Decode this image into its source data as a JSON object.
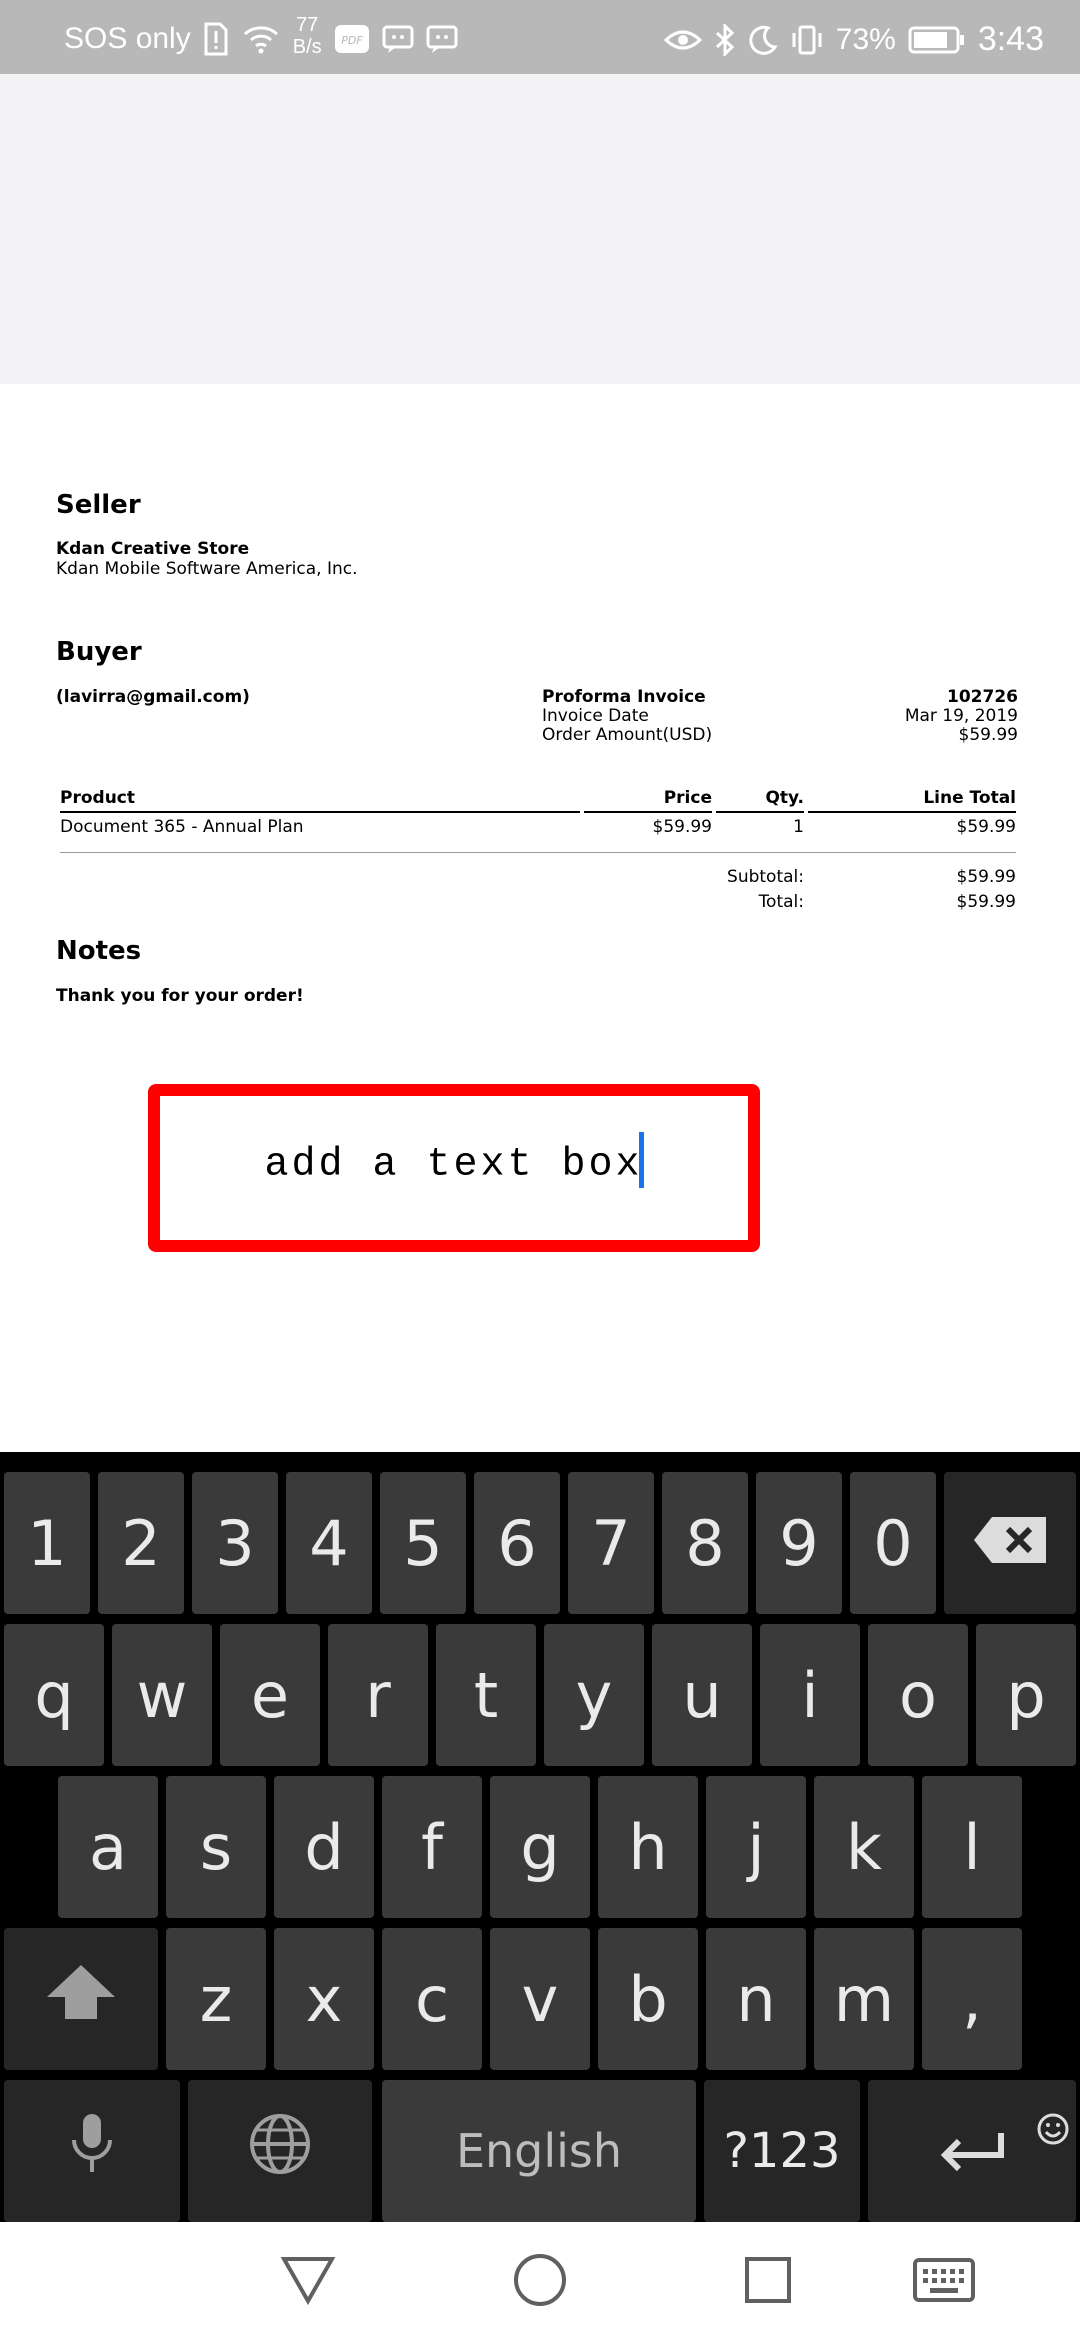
{
  "status_bar": {
    "carrier": "SOS only",
    "net_speed_value": "77",
    "net_speed_unit": "B/s",
    "battery": "73%",
    "time": "3:43"
  },
  "document": {
    "seller_heading": "Seller",
    "seller_name": "Kdan Creative Store",
    "seller_company": "Kdan Mobile Software America, Inc.",
    "buyer_heading": "Buyer",
    "buyer_email": "(lavirra@gmail.com)",
    "invoice_label": "Proforma Invoice",
    "invoice_number": "102726",
    "invoice_date_label": "Invoice Date",
    "invoice_date": "Mar 19, 2019",
    "order_amount_label": "Order Amount(USD)",
    "order_amount": "$59.99",
    "table": {
      "headers": [
        "Product",
        "Price",
        "Qty.",
        "Line Total"
      ],
      "rows": [
        [
          "Document 365 - Annual Plan",
          "$59.99",
          "1",
          "$59.99"
        ]
      ]
    },
    "subtotal_label": "Subtotal:",
    "subtotal": "$59.99",
    "total_label": "Total:",
    "total": "$59.99",
    "notes_heading": "Notes",
    "notes_text": "Thank you for your order!"
  },
  "text_box": {
    "value": "add a text box",
    "border_color": "#ff0000",
    "caret_color": "#1a73e8"
  },
  "keyboard": {
    "row1": [
      "1",
      "2",
      "3",
      "4",
      "5",
      "6",
      "7",
      "8",
      "9",
      "0"
    ],
    "row2": [
      "q",
      "w",
      "e",
      "r",
      "t",
      "y",
      "u",
      "i",
      "o",
      "p"
    ],
    "row3": [
      "a",
      "s",
      "d",
      "f",
      "g",
      "h",
      "j",
      "k",
      "l"
    ],
    "row4": [
      "z",
      "x",
      "c",
      "v",
      "b",
      "n",
      "m",
      ","
    ],
    "space_label": "English",
    "symbols_label": "?123",
    "icons": [
      "backspace-icon",
      "shift-icon",
      "microphone-icon",
      "globe-icon",
      "emoji-icon",
      "enter-icon"
    ]
  },
  "nav_bar": {
    "icons": [
      "back-triangle-icon",
      "home-circle-icon",
      "recents-square-icon",
      "keyboard-icon"
    ]
  }
}
